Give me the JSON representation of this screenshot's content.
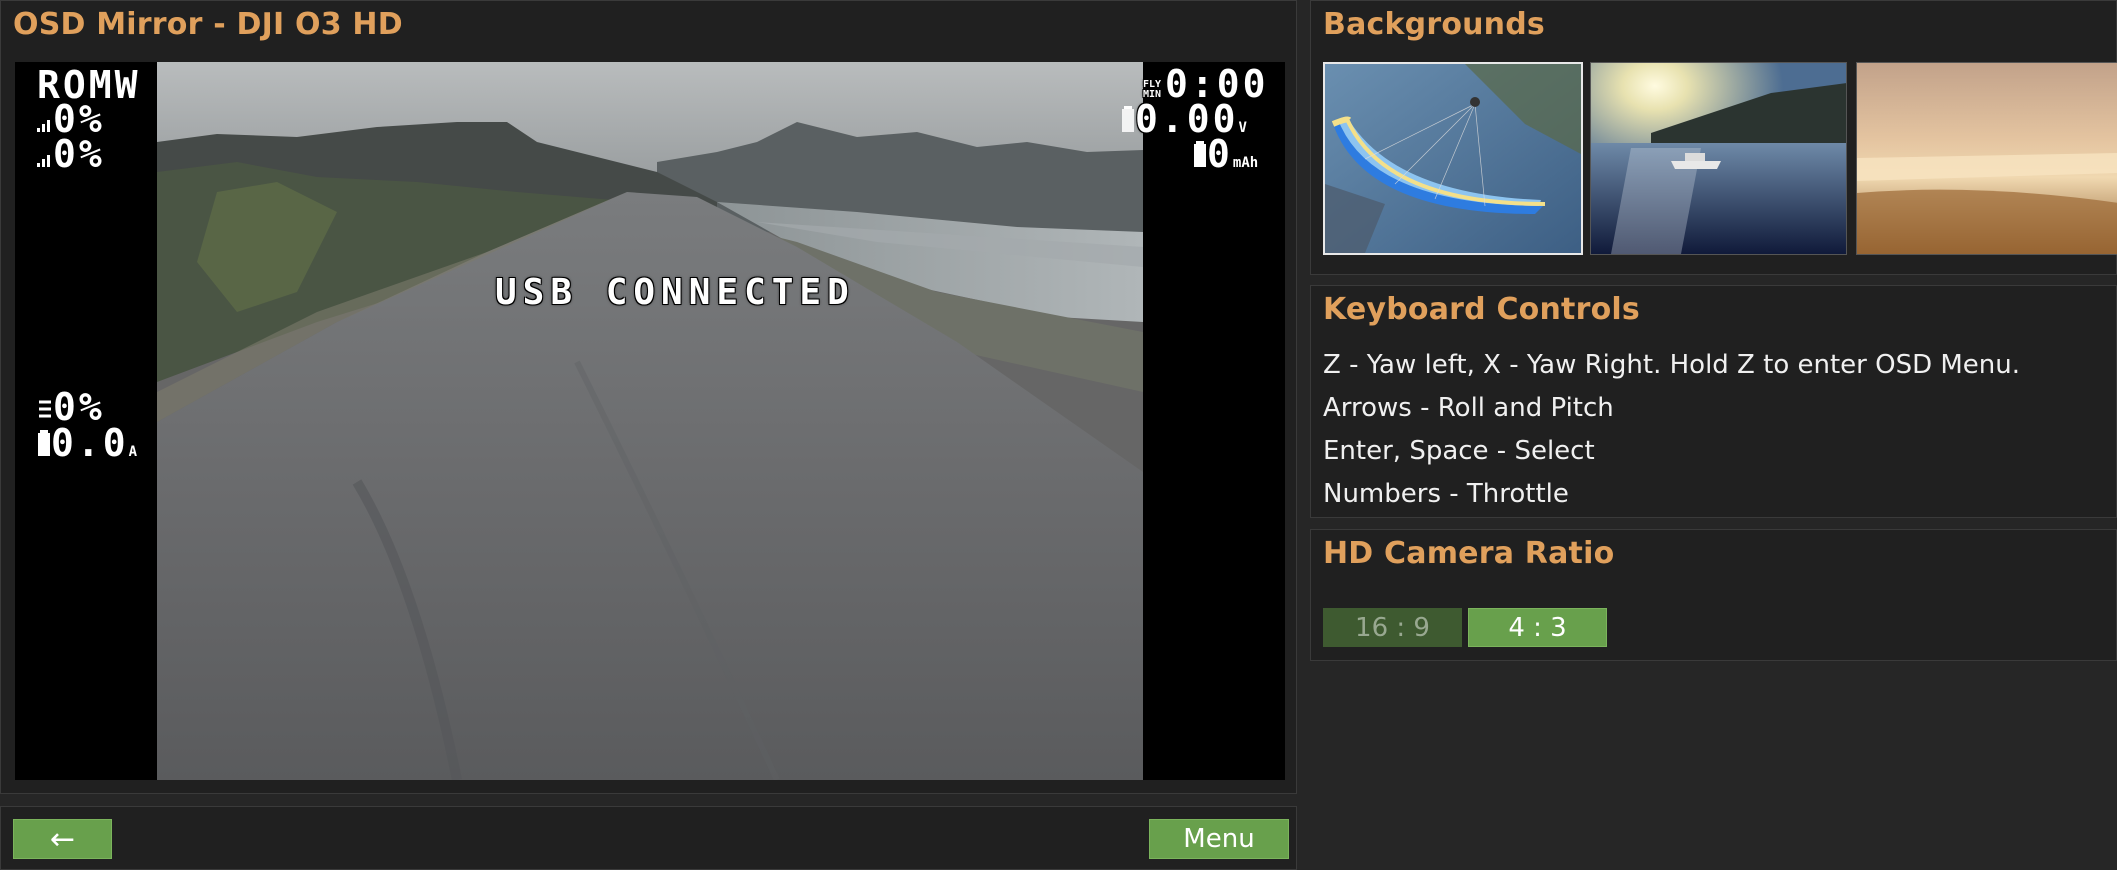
{
  "osd_panel": {
    "title": "OSD Mirror - DJI O3 HD",
    "osd": {
      "top_left": {
        "label": "ROMW",
        "signal_1": "0%",
        "signal_2": "0%"
      },
      "top_right": {
        "fly_time_label": "FLY MIN",
        "fly_time": "0:00",
        "voltage": "0.00",
        "voltage_unit": "V",
        "mah": "0",
        "mah_unit": "mAh"
      },
      "left_mid": {
        "throttle": "0%",
        "current": "0.0",
        "current_unit": "A"
      },
      "center_message": "USB CONNECTED"
    }
  },
  "bottom_bar": {
    "back_label": "←",
    "menu_label": "Menu"
  },
  "backgrounds": {
    "title": "Backgrounds",
    "thumbnails": [
      {
        "icon": "paraglider-image",
        "selected": true
      },
      {
        "icon": "boat-sunset-image",
        "selected": false
      },
      {
        "icon": "beach-sunset-image",
        "selected": false
      }
    ]
  },
  "keyboard_controls": {
    "title": "Keyboard Controls",
    "lines": [
      "Z - Yaw left, X - Yaw Right. Hold Z to enter OSD Menu.",
      "Arrows - Roll and Pitch",
      "Enter, Space - Select",
      "Numbers - Throttle"
    ]
  },
  "hd_camera_ratio": {
    "title": "HD Camera Ratio",
    "options": [
      "16 : 9",
      "4 : 3"
    ],
    "selected": "4 : 3"
  },
  "colors": {
    "accent": "#e0a05c",
    "button_green": "#68a04c",
    "button_green_dim": "#3e5a30",
    "panel_bg": "#202020"
  }
}
